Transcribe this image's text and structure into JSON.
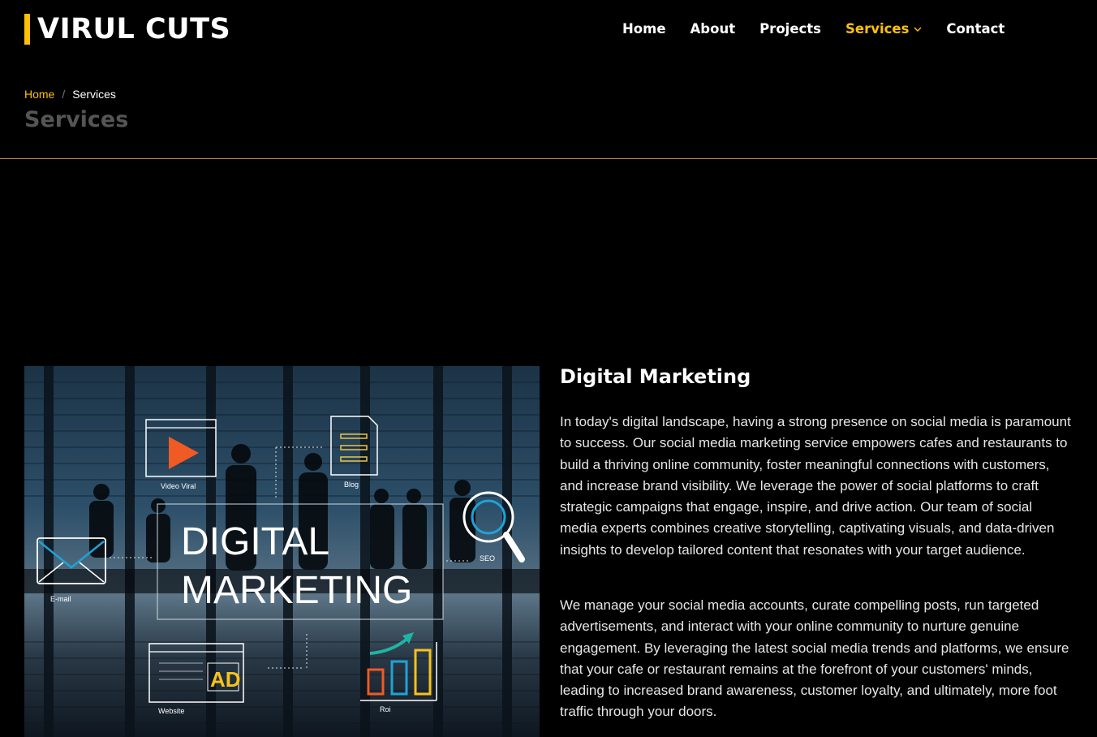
{
  "brand": {
    "name": "VIRUL CUTS",
    "accent": "#ffc107"
  },
  "nav": {
    "items": [
      "Home",
      "About",
      "Projects",
      "Services",
      "Contact"
    ],
    "active": "Services"
  },
  "breadcrumb": {
    "home": "Home",
    "separator": "/",
    "current": "Services"
  },
  "page_title": "Services",
  "section": {
    "title": "Digital Marketing",
    "paragraphs": [
      "In today's digital landscape, having a strong presence on social media is paramount to success. Our social media marketing service empowers cafes and restaurants to build a thriving online community, foster meaningful connections with customers, and increase brand visibility. We leverage the power of social platforms to craft strategic campaigns that engage, inspire, and drive action. Our team of social media experts combines creative storytelling, captivating visuals, and data-driven insights to develop tailored content that resonates with your target audience.",
      "We manage your social media accounts, curate compelling posts, run targeted advertisements, and interact with your online community to nurture genuine engagement. By leveraging the latest social media trends and platforms, we ensure that your cafe or restaurant remains at the forefront of your customers' minds, leading to increased brand awareness, customer loyalty, and ultimately, more foot traffic through your doors."
    ]
  },
  "image": {
    "headline_line1": "DIGITAL",
    "headline_line2": "MARKETING",
    "labels": {
      "video": "Video Viral",
      "blog": "Blog",
      "email": "E-mail",
      "seo": "SEO",
      "website": "Website",
      "roi": "Roi",
      "ad": "AD"
    },
    "icon_colors": {
      "play": "#f05a24",
      "doc": "#e8c547",
      "search": "#1fa3d6",
      "mail": "#1fa3d6",
      "arrow": "#1fb5a5",
      "bar1": "#f05a24",
      "bar2": "#1fa3d6",
      "bar3": "#f6c21c",
      "ad": "#f6c21c"
    }
  }
}
